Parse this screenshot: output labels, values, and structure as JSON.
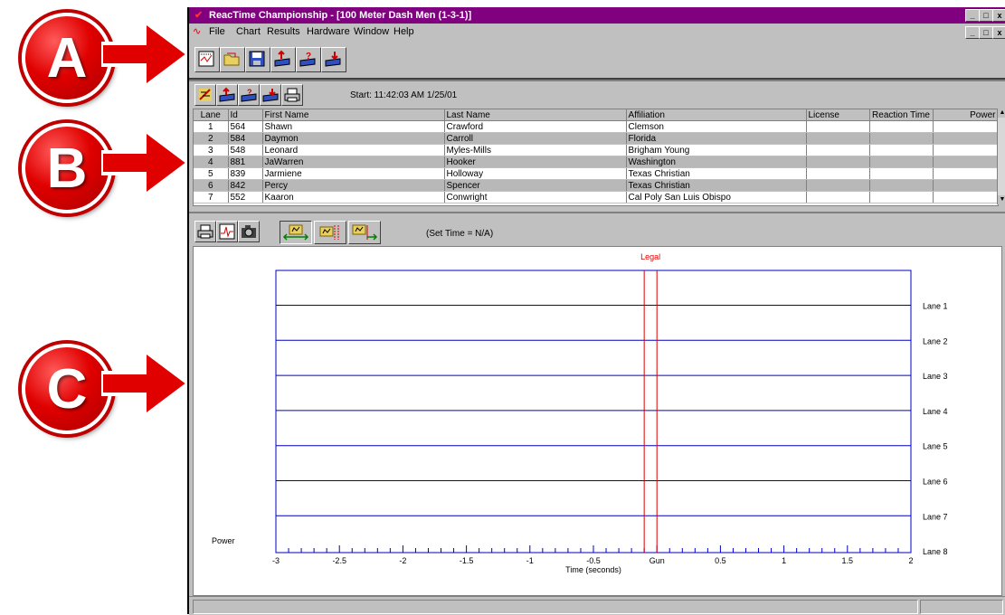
{
  "window": {
    "title": "ReacTime Championship - [100 Meter Dash Men (1-3-1)]",
    "min_label": "_",
    "max_label": "□",
    "close_label": "x"
  },
  "menu": [
    "File",
    "Chart",
    "Results",
    "Hardware",
    "Window",
    "Help"
  ],
  "callouts": [
    "A",
    "B",
    "C"
  ],
  "toolbar_main": [
    {
      "icon": "chart-window-icon"
    },
    {
      "icon": "open-folder-icon"
    },
    {
      "icon": "save-disk-icon"
    },
    {
      "icon": "export-up-icon"
    },
    {
      "icon": "help-query-icon"
    },
    {
      "icon": "import-down-icon"
    }
  ],
  "results_panel": {
    "start_label": "Start:  11:42:03 AM 1/25/01",
    "columns": [
      "Lane",
      "Id",
      "First Name",
      "Last Name",
      "Affiliation",
      "License",
      "Reaction Time",
      "Power"
    ],
    "rows": [
      [
        "1",
        "564",
        "Shawn",
        "Crawford",
        "Clemson",
        "",
        "",
        ""
      ],
      [
        "2",
        "584",
        "Daymon",
        "Carroll",
        "Florida",
        "",
        "",
        ""
      ],
      [
        "3",
        "548",
        "Leonard",
        "Myles-Mills",
        "Brigham Young",
        "",
        "",
        ""
      ],
      [
        "4",
        "881",
        "JaWarren",
        "Hooker",
        "Washington",
        "",
        "",
        ""
      ],
      [
        "5",
        "839",
        "Jarmiene",
        "Holloway",
        "Texas Christian",
        "",
        "",
        ""
      ],
      [
        "6",
        "842",
        "Percy",
        "Spencer",
        "Texas Christian",
        "",
        "",
        ""
      ],
      [
        "7",
        "552",
        "Kaaron",
        "Conwright",
        "Cal Poly San Luis Obispo",
        "",
        "",
        ""
      ]
    ]
  },
  "chart_panel": {
    "set_time_label": "(Set Time = N/A)"
  },
  "chart_data": {
    "type": "line",
    "title": "",
    "xlabel": "Time (seconds)",
    "ylabel": "Power",
    "xlim": [
      -3,
      2
    ],
    "x_ticks": [
      "-3",
      "-2.5",
      "-2",
      "-1.5",
      "-1",
      "-0.5",
      "Gun",
      "0.5",
      "1",
      "1.5",
      "2"
    ],
    "lanes": [
      "Lane 1",
      "Lane 2",
      "Lane 3",
      "Lane 4",
      "Lane 5",
      "Lane 6",
      "Lane 7",
      "Lane 8"
    ],
    "legal_label": "Legal",
    "legal_window": [
      -0.1,
      0.0
    ],
    "series_color": "#0000c0",
    "marker_color": "#e00000"
  }
}
